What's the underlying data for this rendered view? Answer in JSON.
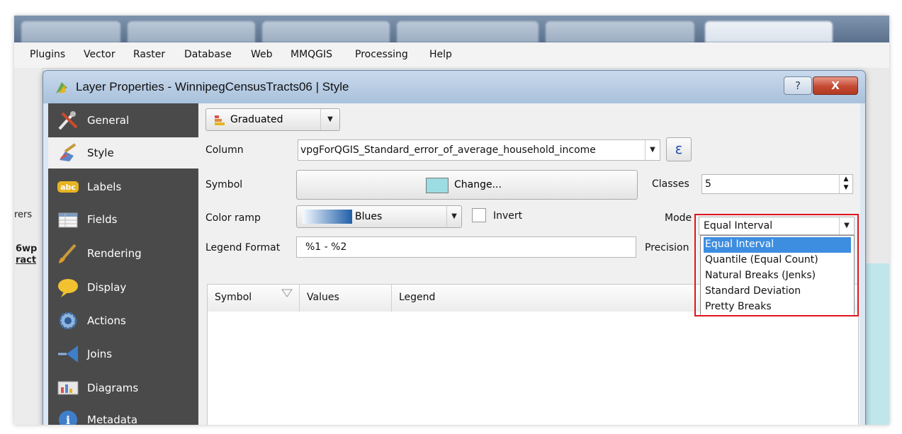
{
  "menubar": {
    "items": [
      "Plugins",
      "Vector",
      "Raster",
      "Database",
      "Web",
      "MMQGIS",
      "Processing",
      "Help"
    ]
  },
  "left_panel": {
    "layers_label": "rers",
    "layer_name_1": "6wp",
    "layer_name_2": "ract"
  },
  "dialog": {
    "title": "Layer Properties - WinnipegCensusTracts06 | Style",
    "help_glyph": "?",
    "close_glyph": "X"
  },
  "sidebar": {
    "items": [
      {
        "label": "General",
        "icon": "tools-icon"
      },
      {
        "label": "Style",
        "icon": "paintbrush-icon"
      },
      {
        "label": "Labels",
        "icon": "abc-label-icon"
      },
      {
        "label": "Fields",
        "icon": "table-icon"
      },
      {
        "label": "Rendering",
        "icon": "brush-icon"
      },
      {
        "label": "Display",
        "icon": "speech-bubble-icon"
      },
      {
        "label": "Actions",
        "icon": "gear-icon"
      },
      {
        "label": "Joins",
        "icon": "arrow-join-icon"
      },
      {
        "label": "Diagrams",
        "icon": "diagram-icon"
      },
      {
        "label": "Metadata",
        "icon": "info-icon"
      }
    ],
    "active_index": 1
  },
  "style": {
    "renderer": "Graduated",
    "column_label": "Column",
    "column_value": "vpgForQGIS_Standard_error_of_average_household_income",
    "expression_glyph": "ε",
    "symbol_label": "Symbol",
    "change_button": "Change...",
    "classes_label": "Classes",
    "classes_value": "5",
    "color_ramp_label": "Color ramp",
    "color_ramp_value": "Blues",
    "invert_label": "Invert",
    "mode_label": "Mode",
    "mode_value": "Equal Interval",
    "legend_format_label": "Legend Format",
    "legend_format_value": "%1 - %2",
    "precision_label": "Precision",
    "table_headers": [
      "Symbol",
      "Values",
      "Legend"
    ]
  },
  "mode_dropdown": {
    "options": [
      "Equal Interval",
      "Quantile (Equal Count)",
      "Natural Breaks (Jenks)",
      "Standard Deviation",
      "Pretty Breaks"
    ],
    "selected_index": 0
  },
  "colors": {
    "sidebar_bg": "#4a4a4a",
    "symbol_swatch": "#9bdde3",
    "selection_blue": "#3d8ee0",
    "highlight_red": "#e0141e"
  }
}
